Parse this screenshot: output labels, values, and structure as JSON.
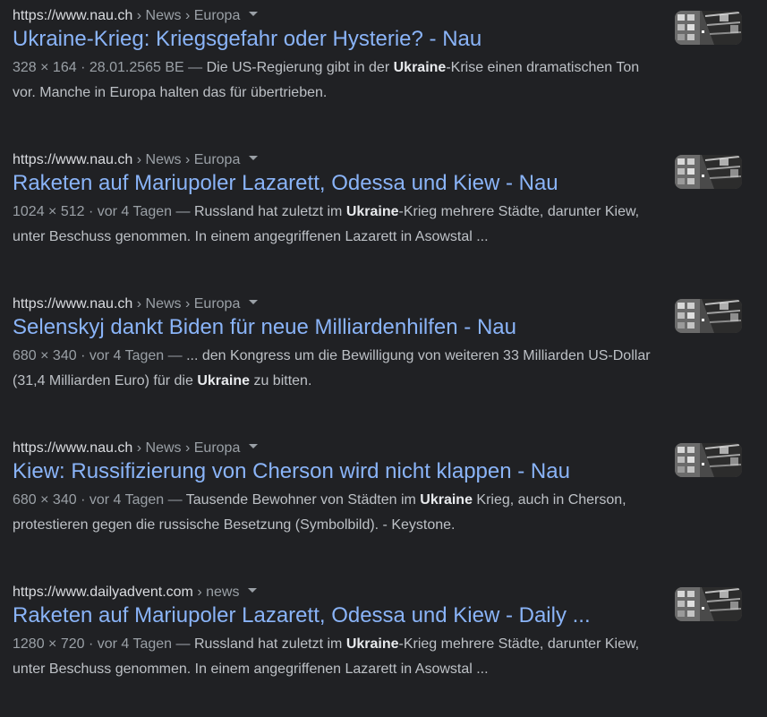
{
  "results": [
    {
      "url_host": "https://www.nau.ch",
      "url_path": " › News › Europa",
      "title": "Ukraine-Krieg: Kriegsgefahr oder Hysterie? - Nau",
      "meta": "328 × 164 · 28.01.2565 BE — ",
      "snippet_a": "Die US-Regierung gibt in der ",
      "snippet_bold": "Ukraine",
      "snippet_b": "-Krise einen dramatischen Ton vor. Manche in Europa halten das für übertrieben.",
      "thumbnail_icon": "building-thumbnail"
    },
    {
      "url_host": "https://www.nau.ch",
      "url_path": " › News › Europa",
      "title": "Raketen auf Mariupoler Lazarett, Odessa und Kiew - Nau",
      "meta": "1024 × 512 · vor 4 Tagen — ",
      "snippet_a": "Russland hat zuletzt im ",
      "snippet_bold": "Ukraine",
      "snippet_b": "-Krieg mehrere Städte, darunter Kiew, unter Beschuss genommen. In einem angegriffenen Lazarett in Asowstal ...",
      "thumbnail_icon": "building-thumbnail"
    },
    {
      "url_host": "https://www.nau.ch",
      "url_path": " › News › Europa",
      "title": "Selenskyj dankt Biden für neue Milliardenhilfen - Nau",
      "meta": "680 × 340 · vor 4 Tagen — ",
      "snippet_a": "... den Kongress um die Bewilligung von weiteren 33 Milliarden US-Dollar (31,4 Milliarden Euro) für die ",
      "snippet_bold": "Ukraine",
      "snippet_b": " zu bitten.",
      "thumbnail_icon": "building-thumbnail"
    },
    {
      "url_host": "https://www.nau.ch",
      "url_path": " › News › Europa",
      "title": "Kiew: Russifizierung von Cherson wird nicht klappen - Nau",
      "meta": "680 × 340 · vor 4 Tagen — ",
      "snippet_a": "Tausende Bewohner von Städten im ",
      "snippet_bold": "Ukraine",
      "snippet_b": " Krieg, auch in Cherson, protestieren gegen die russische Besetzung (Symbolbild). - Keystone.",
      "thumbnail_icon": "building-thumbnail"
    },
    {
      "url_host": "https://www.dailyadvent.com",
      "url_path": " › news",
      "title": "Raketen auf Mariupoler Lazarett, Odessa und Kiew - Daily ...",
      "meta": "1280 × 720 · vor 4 Tagen — ",
      "snippet_a": "Russland hat zuletzt im ",
      "snippet_bold": "Ukraine",
      "snippet_b": "-Krieg mehrere Städte, darunter Kiew, unter Beschuss genommen. In einem angegriffenen Lazarett in Asowstal ...",
      "thumbnail_icon": "building-thumbnail"
    }
  ]
}
